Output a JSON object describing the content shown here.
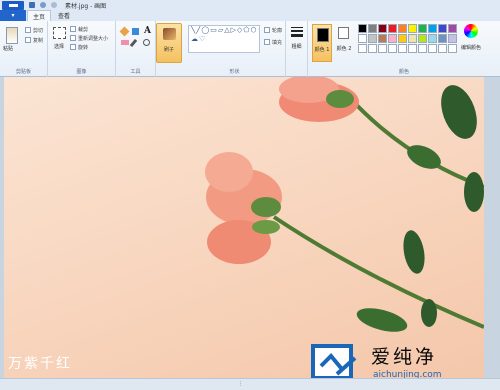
{
  "window": {
    "title": "素材.jpg - 画图"
  },
  "tabs": {
    "home": "主页",
    "view": "查看"
  },
  "ribbon": {
    "clipboard": {
      "paste": "粘贴",
      "cut": "剪切",
      "copy": "复制",
      "label": "剪贴板"
    },
    "image": {
      "select": "选择",
      "crop": "裁剪",
      "resize": "重新调整大小",
      "rotate": "旋转",
      "label": "图像"
    },
    "tools": {
      "label": "工具"
    },
    "brushes": {
      "label": "刷子"
    },
    "shapes": {
      "outline": "轮廓",
      "fill": "填充",
      "label": "形状",
      "glyphs": "╲╱◯▭▱△▷◇⬠⬡☆★✦✧⬅➡⬆⬇◁▷▽⌒☁♡"
    },
    "size": {
      "label": "粗细"
    },
    "colors": {
      "color1": "颜色 1",
      "color2": "颜色 2",
      "edit": "编辑颜色",
      "label": "颜色",
      "palette": [
        "#000000",
        "#7f7f7f",
        "#880015",
        "#ed1c24",
        "#ff7f27",
        "#fff200",
        "#22b14c",
        "#00a2e8",
        "#3f48cc",
        "#a349a4",
        "#ffffff",
        "#c3c3c3",
        "#b97a57",
        "#ffaec9",
        "#ffc90e",
        "#efe4b0",
        "#b5e61d",
        "#99d9ea",
        "#7092be",
        "#c8bfe7",
        "#ffffff",
        "#ffffff",
        "#ffffff",
        "#ffffff",
        "#ffffff",
        "#ffffff",
        "#ffffff",
        "#ffffff",
        "#ffffff",
        "#ffffff"
      ]
    }
  },
  "canvas": {
    "signature": "万紫千红"
  },
  "watermark": {
    "title": "爱纯净",
    "url": "aichunjing.com"
  }
}
